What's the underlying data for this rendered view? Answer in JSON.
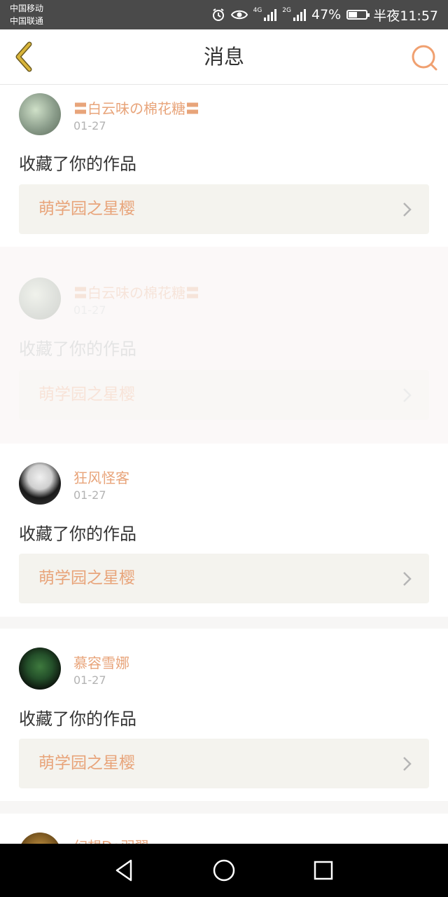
{
  "status_bar": {
    "carrier_1": "中国移动",
    "carrier_2": "中国联通",
    "network_1": "4G",
    "network_2": "2G",
    "battery_percent": "47%",
    "battery_level": 0.47,
    "time": "半夜11:57",
    "icons": [
      "alarm-icon",
      "eye-icon",
      "signal-icon",
      "battery-icon"
    ]
  },
  "header": {
    "title": "消息",
    "back_icon": "chevron-left-icon",
    "search_icon": "search-icon",
    "accent_color": "#e8a47a",
    "back_color": "#d9b53a"
  },
  "messages": [
    {
      "user": "〓白云味の棉花糖〓",
      "date": "01-27",
      "action": "收藏了你的作品",
      "work": "萌学园之星樱"
    },
    {
      "user": "〓白云味の棉花糖〓",
      "date": "01-27",
      "action": "收藏了你的作品",
      "work": "萌学园之星樱"
    },
    {
      "user": "狂风怪客",
      "date": "01-27",
      "action": "收藏了你的作品",
      "work": "萌学园之星樱"
    },
    {
      "user": "慕容雪娜",
      "date": "01-27",
      "action": "收藏了你的作品",
      "work": "萌学园之星樱"
    },
    {
      "user": "幻想Da羽翼",
      "date": "",
      "action": "",
      "work": ""
    }
  ],
  "nav_bar": {
    "icons": [
      "back-triangle-icon",
      "home-circle-icon",
      "recents-square-icon"
    ]
  }
}
